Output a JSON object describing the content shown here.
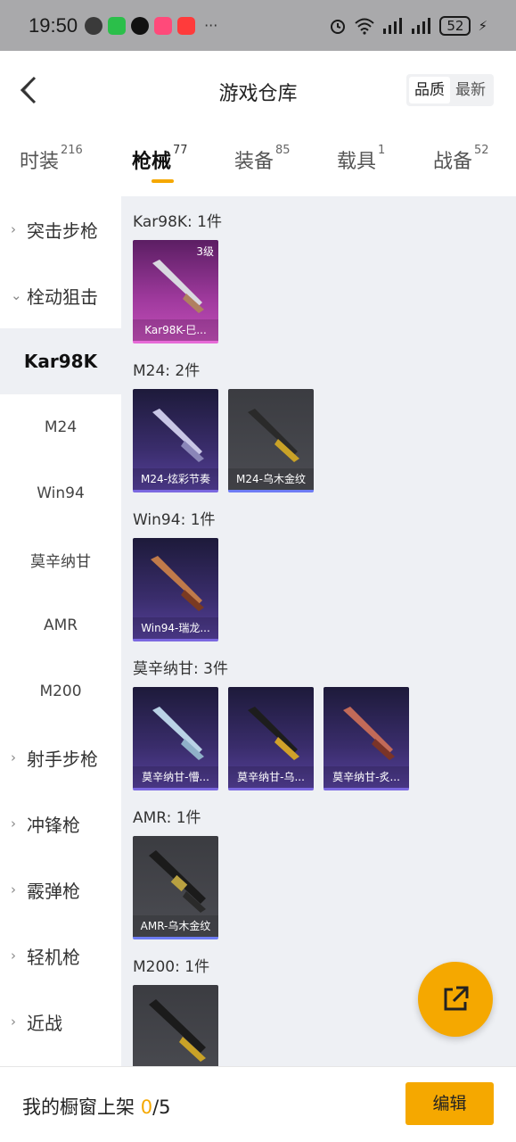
{
  "status_bar": {
    "time": "19:50",
    "more": "···",
    "battery": "52",
    "app_icons": [
      "game-app-icon",
      "wechat-icon",
      "qq-icon",
      "video-app-icon",
      "message-app-icon"
    ],
    "app_colors": [
      "#3a3a3a",
      "#2bbf4a",
      "#111111",
      "#ff4a7a",
      "#ff3b3b"
    ]
  },
  "header": {
    "title": "游戏仓库",
    "sort_options": [
      "品质",
      "最新"
    ]
  },
  "tabs": [
    {
      "label": "时装",
      "count": "216"
    },
    {
      "label": "枪械",
      "count": "77"
    },
    {
      "label": "装备",
      "count": "85"
    },
    {
      "label": "载具",
      "count": "1"
    },
    {
      "label": "战备",
      "count": "52"
    }
  ],
  "sidebar": {
    "items": [
      {
        "label": "突击步枪",
        "type": "group",
        "expanded": false
      },
      {
        "label": "栓动狙击",
        "type": "group",
        "expanded": true
      },
      {
        "label": "Kar98K",
        "type": "sub",
        "active": true
      },
      {
        "label": "M24",
        "type": "sub"
      },
      {
        "label": "Win94",
        "type": "sub"
      },
      {
        "label": "莫辛纳甘",
        "type": "sub"
      },
      {
        "label": "AMR",
        "type": "sub"
      },
      {
        "label": "M200",
        "type": "sub"
      },
      {
        "label": "射手步枪",
        "type": "group",
        "expanded": false
      },
      {
        "label": "冲锋枪",
        "type": "group",
        "expanded": false
      },
      {
        "label": "霰弹枪",
        "type": "group",
        "expanded": false
      },
      {
        "label": "轻机枪",
        "type": "group",
        "expanded": false
      },
      {
        "label": "近战",
        "type": "group",
        "expanded": false
      }
    ]
  },
  "groups": [
    {
      "title": "Kar98K: 1件",
      "items": [
        {
          "name": "Kar98K-巳...",
          "level": "3级",
          "rarity": "pink",
          "gun_color": "#d9d9e0"
        }
      ]
    },
    {
      "title": "M24: 2件",
      "items": [
        {
          "name": "M24-炫彩节奏",
          "rarity": "purple",
          "gun_color": "#c9c7e6"
        },
        {
          "name": "M24-乌木金纹",
          "rarity": "gray",
          "gun_color": "#c9a227"
        }
      ]
    },
    {
      "title": "Win94: 1件",
      "items": [
        {
          "name": "Win94-瑞龙...",
          "rarity": "purple",
          "gun_color": "#c07a4a"
        }
      ]
    },
    {
      "title": "莫辛纳甘: 3件",
      "items": [
        {
          "name": "莫辛纳甘-懵...",
          "rarity": "purple",
          "gun_color": "#b9d2e6"
        },
        {
          "name": "莫辛纳甘-乌...",
          "rarity": "purple",
          "gun_color": "#d1a12a"
        },
        {
          "name": "莫辛纳甘-炙...",
          "rarity": "purple",
          "gun_color": "#c26a58"
        }
      ]
    },
    {
      "title": "AMR: 1件",
      "items": [
        {
          "name": "AMR-乌木金纹",
          "rarity": "gray",
          "gun_color": "#b8a040"
        }
      ]
    },
    {
      "title": "M200: 1件",
      "items": [
        {
          "name": "",
          "rarity": "gray",
          "gun_color": "#c9a227"
        }
      ]
    }
  ],
  "bottom_bar": {
    "label": "我的橱窗上架 ",
    "count": "0",
    "total": "/5",
    "edit_label": "编辑"
  },
  "colors": {
    "accent": "#f5a800",
    "pink_rarity": "#e66ad7",
    "purple_rarity": "#7b68e0",
    "gray_rarity": "#6e7cf4"
  }
}
